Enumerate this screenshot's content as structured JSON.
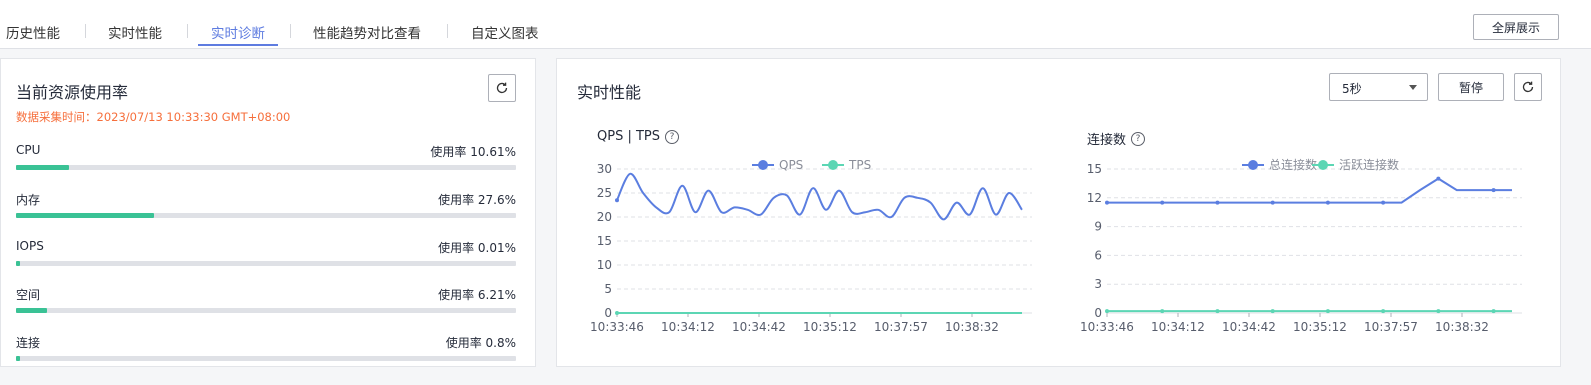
{
  "tabs": [
    {
      "label": "历史性能",
      "active": false
    },
    {
      "label": "实时性能",
      "active": false
    },
    {
      "label": "实时诊断",
      "active": true
    },
    {
      "label": "性能趋势对比查看",
      "active": false
    },
    {
      "label": "自定义图表",
      "active": false
    }
  ],
  "fullscreen_label": "全屏展示",
  "resource_panel": {
    "title": "当前资源使用率",
    "collect_time": "数据采集时间：2023/07/13 10:33:30 GMT+08:00",
    "items": [
      {
        "label": "CPU",
        "usage_text": "使用率 10.61%",
        "percent": 10.61
      },
      {
        "label": "内存",
        "usage_text": "使用率 27.6%",
        "percent": 27.6
      },
      {
        "label": "IOPS",
        "usage_text": "使用率 0.01%",
        "percent": 0.01
      },
      {
        "label": "空间",
        "usage_text": "使用率 6.21%",
        "percent": 6.21
      },
      {
        "label": "连接",
        "usage_text": "使用率 0.8%",
        "percent": 0.8
      }
    ]
  },
  "realtime_panel": {
    "title": "实时性能",
    "interval": "5秒",
    "pause_label": "暂停"
  },
  "colors": {
    "accent": "#5e7ce0",
    "series_primary": "#5b7ee0",
    "series_secondary": "#5cd6b4",
    "warning": "#f66f3c",
    "bar": "#3ac295"
  },
  "chart_data": [
    {
      "type": "line",
      "title": "QPS | TPS",
      "x_ticks": [
        "10:33:46",
        "10:34:12",
        "10:34:42",
        "10:35:12",
        "10:37:57",
        "10:38:32"
      ],
      "y_ticks": [
        0,
        5,
        10,
        15,
        20,
        25,
        30
      ],
      "ylim": [
        0,
        30
      ],
      "legend": "top-center",
      "grid": true,
      "series": [
        {
          "name": "QPS",
          "values": [
            23.5,
            29,
            25,
            22,
            21,
            26.5,
            21,
            25.5,
            21,
            22,
            21.5,
            20.5,
            24,
            24.5,
            20.5,
            26,
            21.5,
            25.5,
            21,
            21,
            21.5,
            20,
            24,
            24,
            23,
            19.5,
            23,
            20.5,
            26,
            20.5,
            25,
            21.5
          ]
        },
        {
          "name": "TPS",
          "values": [
            0,
            0,
            0,
            0,
            0,
            0,
            0,
            0,
            0,
            0,
            0,
            0,
            0,
            0,
            0,
            0,
            0,
            0,
            0,
            0,
            0,
            0,
            0,
            0,
            0,
            0,
            0,
            0,
            0,
            0,
            0,
            0
          ]
        }
      ]
    },
    {
      "type": "line",
      "title": "连接数",
      "x_ticks": [
        "10:33:46",
        "10:34:12",
        "10:34:42",
        "10:35:12",
        "10:37:57",
        "10:38:32"
      ],
      "y_ticks": [
        0,
        3,
        6,
        9,
        12,
        15
      ],
      "ylim": [
        0,
        15
      ],
      "legend": "top-center",
      "grid": true,
      "series": [
        {
          "name": "总连接数",
          "values": [
            11.5,
            11.5,
            11.5,
            11.5,
            11.5,
            11.5,
            11.5,
            11.5,
            11.5,
            11.5,
            11.5,
            11.5,
            11.5,
            11.5,
            11.5,
            11.5,
            11.5,
            12.8,
            14,
            12.8,
            12.8,
            12.8,
            12.8
          ]
        },
        {
          "name": "活跃连接数",
          "values": [
            0.2,
            0.2,
            0.2,
            0.2,
            0.2,
            0.2,
            0.2,
            0.2,
            0.2,
            0.2,
            0.2,
            0.2,
            0.2,
            0.2,
            0.2,
            0.2,
            0.2,
            0.2,
            0.2,
            0.2,
            0.2,
            0.2,
            0.2
          ]
        }
      ]
    }
  ]
}
